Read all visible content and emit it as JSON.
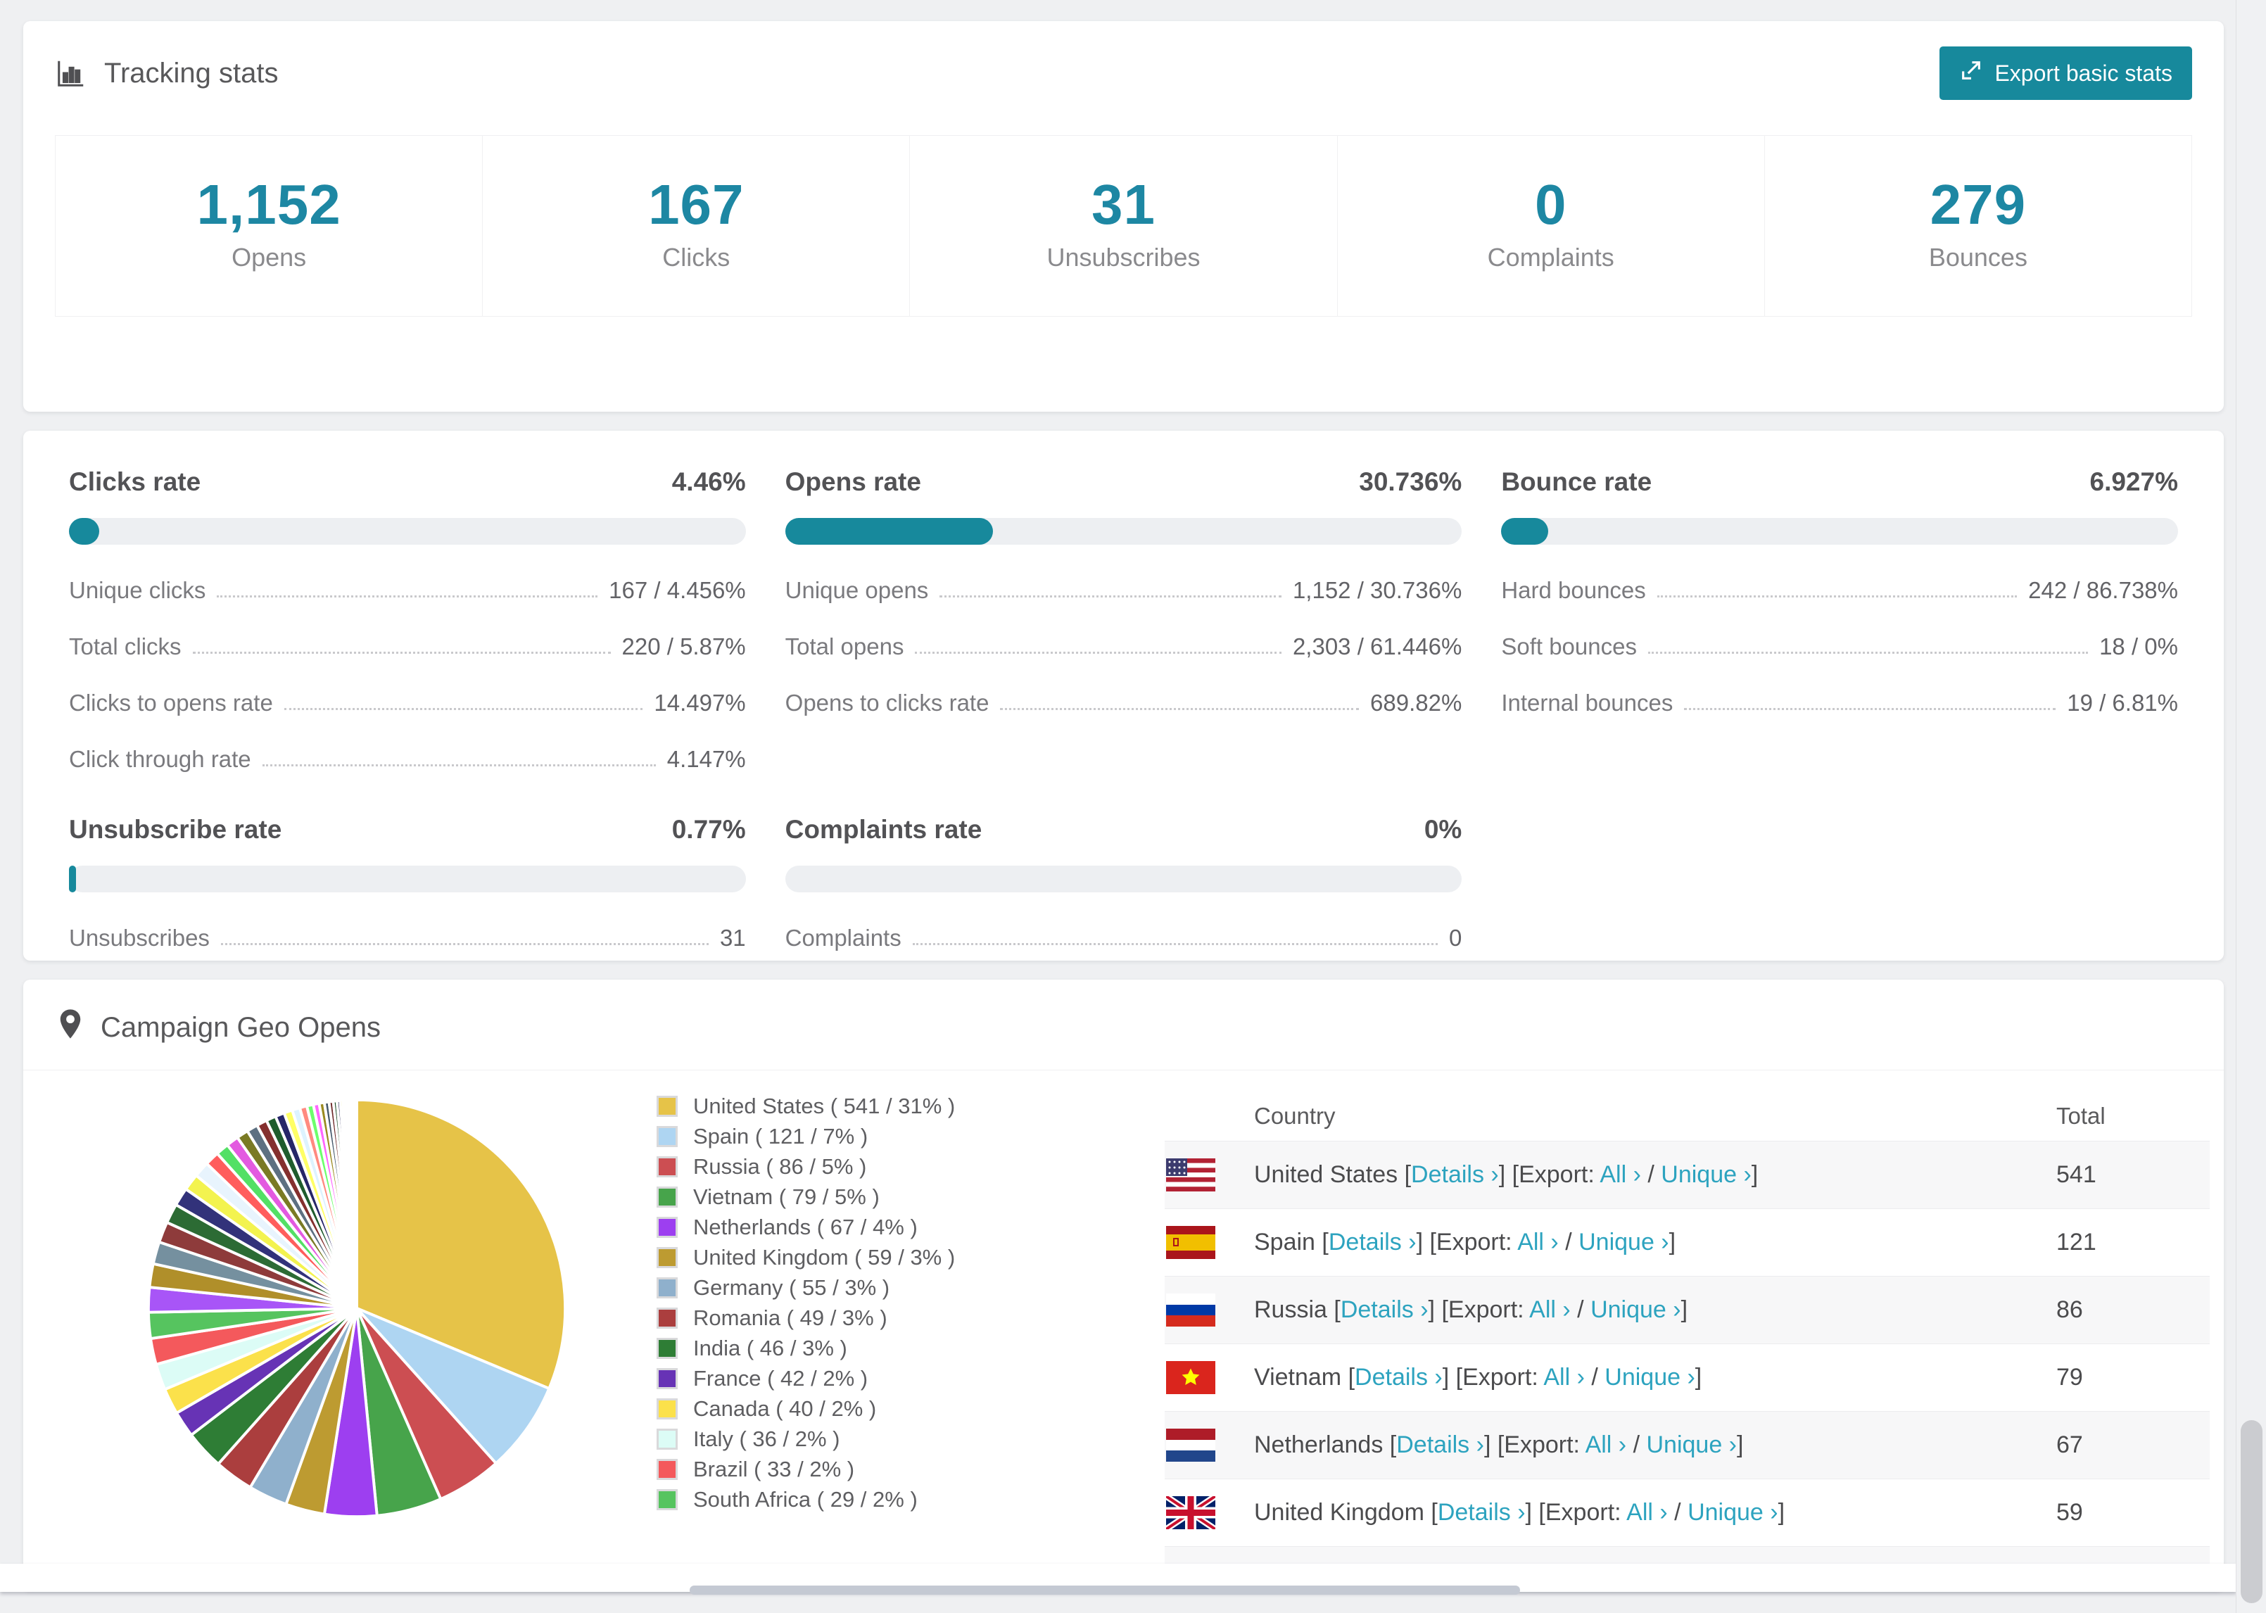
{
  "page": {
    "accent_color": "#17899c",
    "link_color": "#2da3bf",
    "stat_number_color": "#1d87a3",
    "card_background": "#ffffff",
    "page_background": "#eff0f2"
  },
  "tracking": {
    "title": "Tracking stats",
    "title_icon": "bar-chart-icon",
    "export_button": "Export basic stats",
    "export_icon": "export-arrow-icon",
    "stats": [
      {
        "value": "1,152",
        "label": "Opens"
      },
      {
        "value": "167",
        "label": "Clicks"
      },
      {
        "value": "31",
        "label": "Unsubscribes"
      },
      {
        "value": "0",
        "label": "Complaints"
      },
      {
        "value": "279",
        "label": "Bounces"
      }
    ]
  },
  "rates": {
    "blocks": [
      {
        "title": "Clicks rate",
        "value": "4.46%",
        "percent": 4.46,
        "rows": [
          {
            "label": "Unique clicks",
            "value": "167 / 4.456%"
          },
          {
            "label": "Total clicks",
            "value": "220 / 5.87%"
          },
          {
            "label": "Clicks to opens rate",
            "value": "14.497%"
          },
          {
            "label": "Click through rate",
            "value": "4.147%"
          }
        ]
      },
      {
        "title": "Opens rate",
        "value": "30.736%",
        "percent": 30.736,
        "rows": [
          {
            "label": "Unique opens",
            "value": "1,152 / 30.736%"
          },
          {
            "label": "Total opens",
            "value": "2,303 / 61.446%"
          },
          {
            "label": "Opens to clicks rate",
            "value": "689.82%"
          }
        ]
      },
      {
        "title": "Bounce rate",
        "value": "6.927%",
        "percent": 6.927,
        "rows": [
          {
            "label": "Hard bounces",
            "value": "242 / 86.738%"
          },
          {
            "label": "Soft bounces",
            "value": "18 / 0%"
          },
          {
            "label": "Internal bounces",
            "value": "19 / 6.81%"
          }
        ]
      },
      {
        "title": "Unsubscribe rate",
        "value": "0.77%",
        "percent": 0.77,
        "rows": [
          {
            "label": "Unsubscribes",
            "value": "31"
          }
        ]
      },
      {
        "title": "Complaints rate",
        "value": "0%",
        "percent": 0,
        "rows": [
          {
            "label": "Complaints",
            "value": "0"
          }
        ]
      }
    ]
  },
  "geo": {
    "title": "Campaign Geo Opens",
    "title_icon": "map-pin-icon",
    "table": {
      "headers": [
        "Country",
        "Total"
      ],
      "links": {
        "bracket_open": "[",
        "details": "Details ›",
        "bracket_mid": "] [Export: ",
        "all": "All ›",
        "separator": " / ",
        "unique": "Unique ›",
        "bracket_close": "]"
      },
      "rows": [
        {
          "country": "United States",
          "total": "541",
          "flag": "us"
        },
        {
          "country": "Spain",
          "total": "121",
          "flag": "es"
        },
        {
          "country": "Russia",
          "total": "86",
          "flag": "ru"
        },
        {
          "country": "Vietnam",
          "total": "79",
          "flag": "vn"
        },
        {
          "country": "Netherlands",
          "total": "67",
          "flag": "nl"
        },
        {
          "country": "United Kingdom",
          "total": "59",
          "flag": "gb"
        },
        {
          "country": "",
          "total": "",
          "flag": "de"
        }
      ]
    }
  },
  "chart_data": {
    "type": "pie",
    "title": "Campaign Geo Opens",
    "legend_position": "right",
    "start_angle_deg": 0,
    "direction": "clockwise",
    "series": [
      {
        "label": "United States",
        "count": "541",
        "pct": 31,
        "color": "#e6c348"
      },
      {
        "label": "Spain",
        "count": "121",
        "pct": 7,
        "color": "#aed5f2"
      },
      {
        "label": "Russia",
        "count": "86",
        "pct": 5,
        "color": "#cc4e52"
      },
      {
        "label": "Vietnam",
        "count": "79",
        "pct": 5,
        "color": "#47a44b"
      },
      {
        "label": "Netherlands",
        "count": "67",
        "pct": 4,
        "color": "#9d3ff0"
      },
      {
        "label": "United Kingdom",
        "count": "59",
        "pct": 3,
        "color": "#bd9b31"
      },
      {
        "label": "Germany",
        "count": "55",
        "pct": 3,
        "color": "#8fb0cc"
      },
      {
        "label": "Romania",
        "count": "49",
        "pct": 3,
        "color": "#ab3e3e"
      },
      {
        "label": "India",
        "count": "46",
        "pct": 3,
        "color": "#2e7d35"
      },
      {
        "label": "France",
        "count": "42",
        "pct": 2,
        "color": "#6733b5"
      },
      {
        "label": "Canada",
        "count": "40",
        "pct": 2,
        "color": "#fbe14b"
      },
      {
        "label": "Italy",
        "count": "36",
        "pct": 2,
        "color": "#dcfcf6"
      },
      {
        "label": "Brazil",
        "count": "33",
        "pct": 2,
        "color": "#f4595c"
      },
      {
        "label": "South Africa",
        "count": "29",
        "pct": 2,
        "color": "#56c45f"
      }
    ],
    "legend_label_format": "{label} ( {count} / {pct}% )",
    "others_tail_note": "long tail of unlabeled small slices, estimated weights in percent",
    "others_pct": [
      1.9,
      1.8,
      1.7,
      1.6,
      1.5,
      1.4,
      1.3,
      1.2,
      1.1,
      1.0,
      0.95,
      0.9,
      0.85,
      0.8,
      0.75,
      0.7,
      0.65,
      0.6,
      0.55,
      0.5,
      0.45,
      0.4,
      0.36,
      0.32,
      0.28,
      0.25,
      0.22,
      0.19,
      0.16,
      0.14,
      0.12,
      0.1,
      0.08,
      0.07,
      0.06,
      0.05,
      0.04,
      0.03
    ],
    "others_colors": [
      "#a855f7",
      "#b08f2a",
      "#75909f",
      "#8e3b3b",
      "#2c6b34",
      "#32327a",
      "#f3f34f",
      "#e8f4fd",
      "#ff5d5d",
      "#53e065",
      "#e35ae0",
      "#7a7a24",
      "#5d7081",
      "#84302e",
      "#1f5c2d",
      "#262668",
      "#ffff66",
      "#ddf3ff",
      "#ff8a80",
      "#6dff6d",
      "#ff66ff",
      "#9a8a20",
      "#44586a",
      "#6d2828",
      "#174a22",
      "#1d1d52",
      "#f7f75e",
      "#cfeaff",
      "#ff9999",
      "#99ff99",
      "#ff99ff",
      "#857a1e",
      "#3a4a58",
      "#5c2222",
      "#123d1c",
      "#141444",
      "#eded55",
      "#bfe3ff"
    ]
  }
}
